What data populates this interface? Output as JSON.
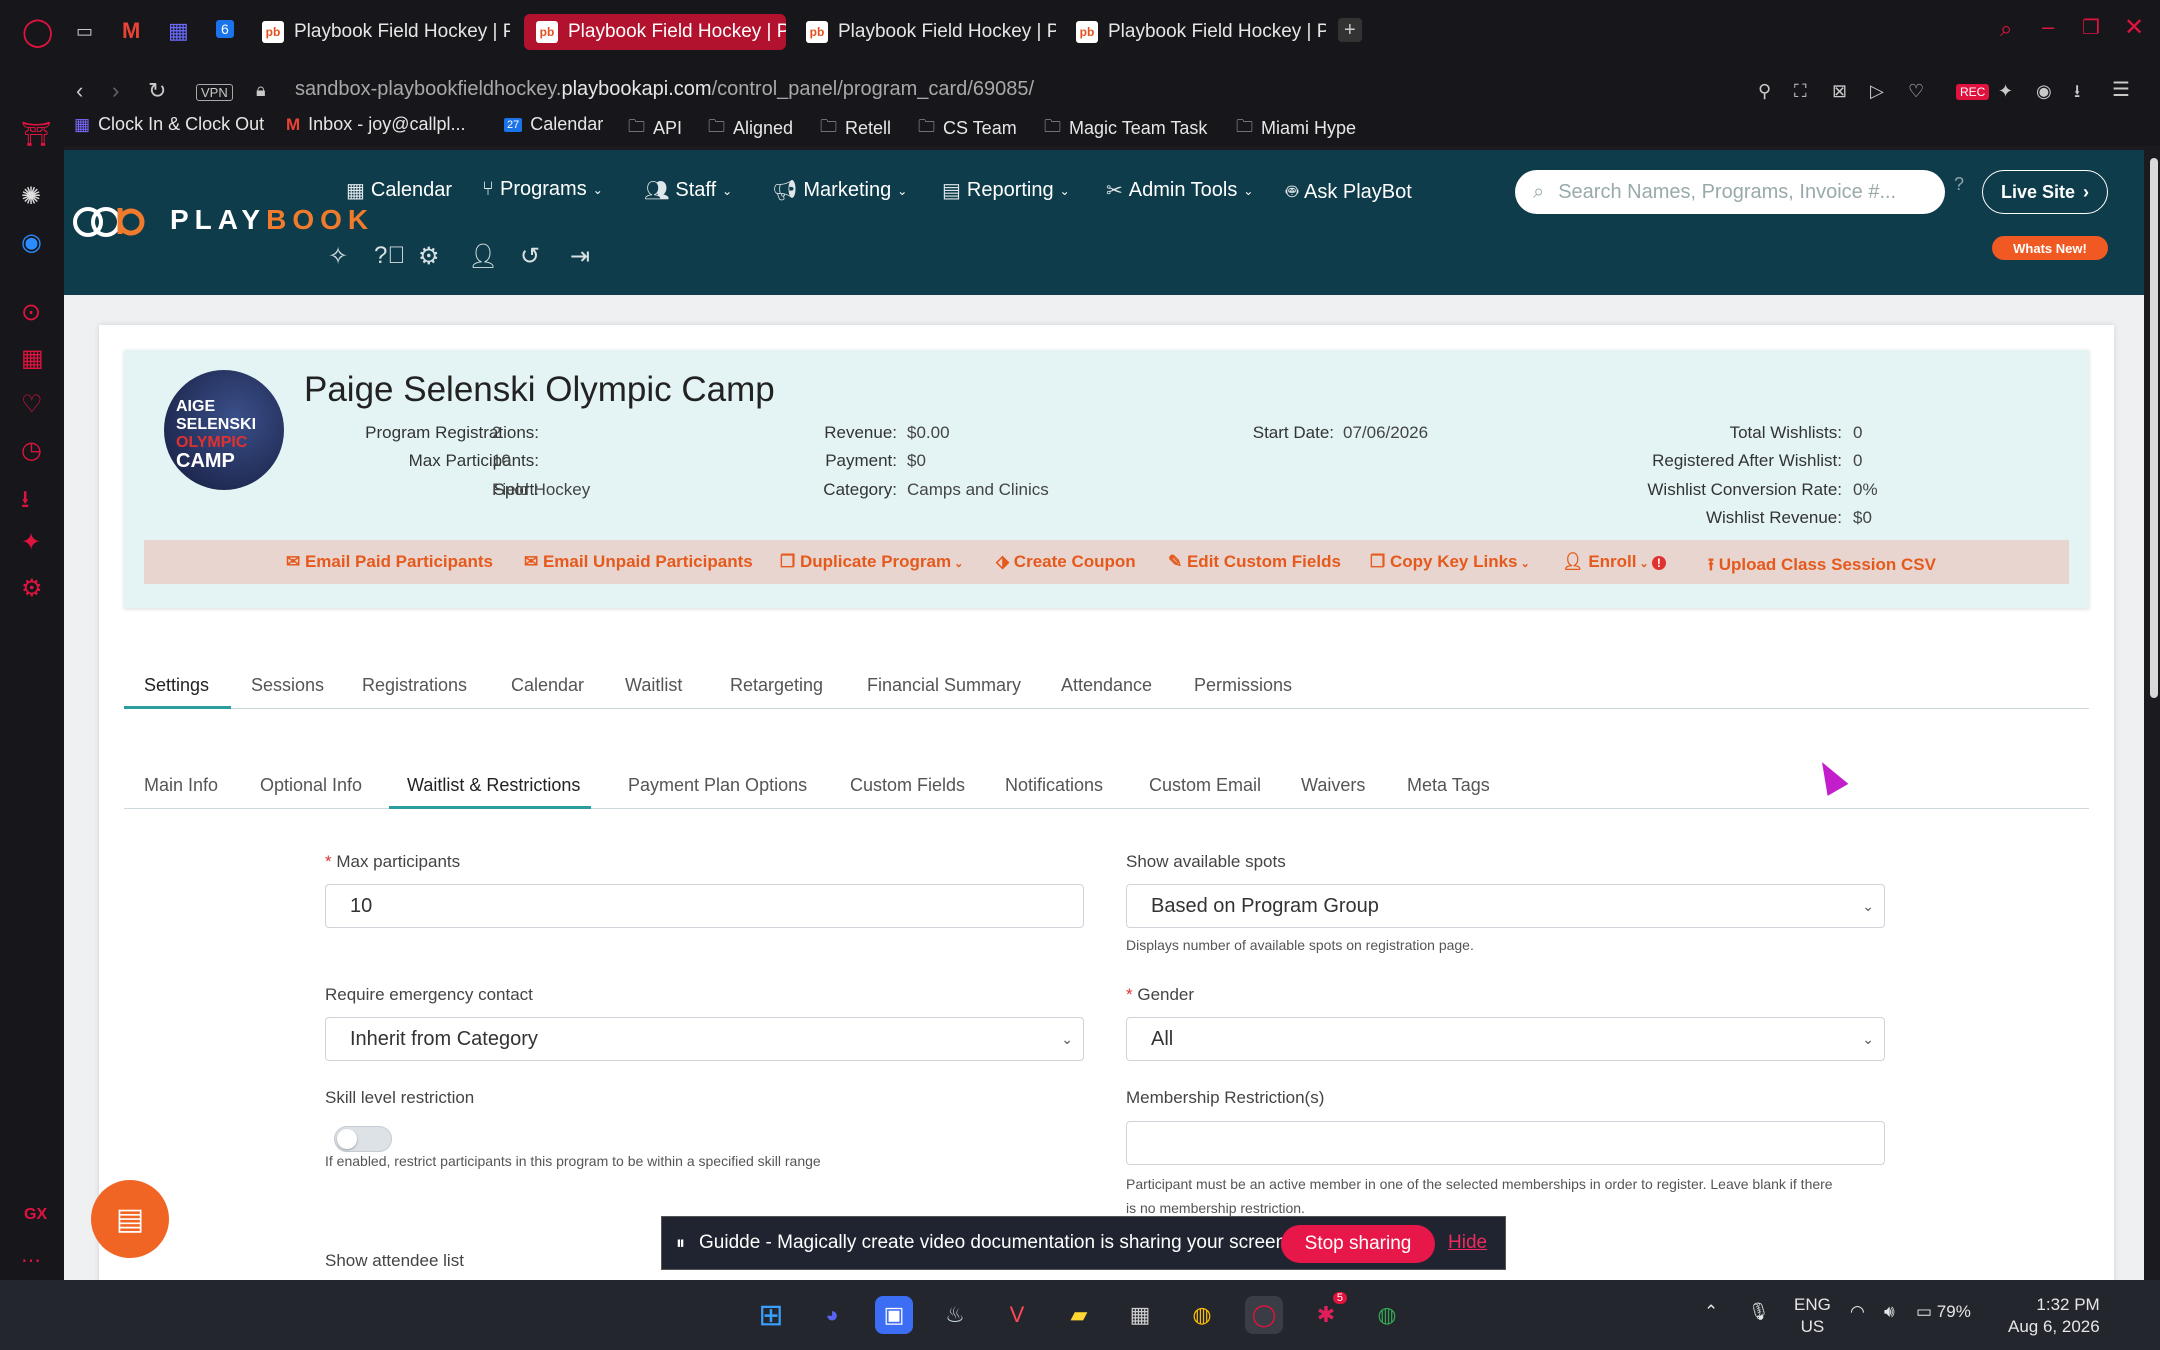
{
  "browser": {
    "tabs": [
      {
        "title": "Playbook Field Hockey | Pla",
        "active": false
      },
      {
        "title": "Playbook Field Hockey | Pla",
        "active": true
      },
      {
        "title": "Playbook Field Hockey | Pla",
        "active": false
      },
      {
        "title": "Playbook Field Hockey | Pla",
        "active": false
      }
    ],
    "vpn_label": "VPN",
    "url_prefix": "sandbox-playbookfieldhockey.",
    "url_domain": "playbookapi.com",
    "url_path": "/control_panel/program_card/69085/",
    "rec_label": "REC",
    "bookmarks": [
      {
        "label": "Clock In & Clock Out",
        "icon": "app-icon"
      },
      {
        "label": "Inbox - joy@callpl...",
        "icon": "gmail-icon"
      },
      {
        "label": "Calendar",
        "icon": "calendar-icon"
      },
      {
        "label": "API",
        "icon": "folder-icon"
      },
      {
        "label": "Aligned",
        "icon": "folder-icon"
      },
      {
        "label": "Retell",
        "icon": "folder-icon"
      },
      {
        "label": "CS Team",
        "icon": "folder-icon"
      },
      {
        "label": "Magic Team Task",
        "icon": "folder-icon"
      },
      {
        "label": "Miami Hype",
        "icon": "folder-icon"
      }
    ],
    "calendar_badge": "27",
    "sidebar_gx": "GX"
  },
  "app": {
    "logo_text_a": "PLAY",
    "logo_text_b": "BOOK",
    "nav": [
      {
        "label": "Calendar",
        "icon": "calendar-icon",
        "dropdown": false
      },
      {
        "label": "Programs",
        "icon": "programs-icon",
        "dropdown": true
      },
      {
        "label": "Staff",
        "icon": "staff-icon",
        "dropdown": true
      },
      {
        "label": "Marketing",
        "icon": "megaphone-icon",
        "dropdown": true
      },
      {
        "label": "Reporting",
        "icon": "report-icon",
        "dropdown": true
      },
      {
        "label": "Admin Tools",
        "icon": "tools-icon",
        "dropdown": true
      },
      {
        "label": "Ask PlayBot",
        "icon": "robot-icon",
        "dropdown": false
      }
    ],
    "search_placeholder": "Search Names, Programs, Invoice #...",
    "live_site_label": "Live Site",
    "whats_new_label": "Whats New!"
  },
  "program": {
    "title": "Paige Selenski Olympic Camp",
    "avatar_lines": [
      "AIGE",
      "SELENSKI",
      "OLYMPIC",
      "CAMP"
    ],
    "stats_col1": [
      {
        "label": "Program Registrations:",
        "value": "2"
      },
      {
        "label": "Max Participants:",
        "value": "10"
      },
      {
        "label": "Sport:",
        "value": "Field Hockey"
      }
    ],
    "stats_col2": [
      {
        "label": "Revenue:",
        "value": "$0.00"
      },
      {
        "label": "Payment:",
        "value": "$0"
      },
      {
        "label": "Category:",
        "value": "Camps and Clinics"
      }
    ],
    "stats_col3": [
      {
        "label": "Start Date:",
        "value": "07/06/2026"
      }
    ],
    "stats_col4": [
      {
        "label": "Total Wishlists:",
        "value": "0"
      },
      {
        "label": "Registered After Wishlist:",
        "value": "0"
      },
      {
        "label": "Wishlist Conversion Rate:",
        "value": "0%"
      },
      {
        "label": "Wishlist Revenue:",
        "value": "$0"
      }
    ],
    "actions": [
      {
        "label": "Email Paid Participants",
        "icon": "envelope-icon"
      },
      {
        "label": "Email Unpaid Participants",
        "icon": "envelope-icon"
      },
      {
        "label": "Duplicate Program",
        "icon": "copy-icon"
      },
      {
        "label": "Create Coupon",
        "icon": "tag-icon"
      },
      {
        "label": "Edit Custom Fields",
        "icon": "pencil-icon"
      },
      {
        "label": "Copy Key Links",
        "icon": "copy-icon"
      },
      {
        "label": "Enroll",
        "icon": "user-plus-icon"
      },
      {
        "label": "Upload Class Session CSV",
        "icon": "upload-icon"
      }
    ]
  },
  "tabs_main": [
    "Settings",
    "Sessions",
    "Registrations",
    "Calendar",
    "Waitlist",
    "Retargeting",
    "Financial Summary",
    "Attendance",
    "Permissions"
  ],
  "tabs_main_selected": "Settings",
  "tabs_sub": [
    "Main Info",
    "Optional Info",
    "Waitlist & Restrictions",
    "Payment Plan Options",
    "Custom Fields",
    "Notifications",
    "Custom Email",
    "Waivers",
    "Meta Tags"
  ],
  "tabs_sub_selected": "Waitlist & Restrictions",
  "form": {
    "max_participants": {
      "label": "Max participants",
      "value": "10",
      "required": true
    },
    "show_available_spots": {
      "label": "Show available spots",
      "value": "Based on Program Group",
      "hint": "Displays number of available spots on registration page."
    },
    "require_emergency_contact": {
      "label": "Require emergency contact",
      "value": "Inherit from Category"
    },
    "gender": {
      "label": "Gender",
      "value": "All",
      "required": true
    },
    "skill_level_restriction": {
      "label": "Skill level restriction",
      "enabled": false,
      "hint": "If enabled, restrict participants in this program to be within a specified skill range"
    },
    "membership_restrictions": {
      "label": "Membership Restriction(s)",
      "value": "",
      "hint_line1": "Participant must be an active member in one of the selected memberships in order to register. Leave blank if there",
      "hint_line2": "is no membership restriction."
    },
    "show_attendee_list": {
      "label": "Show attendee list"
    }
  },
  "guidde": {
    "message": "Guidde - Magically create video documentation is sharing your screen.",
    "stop_label": "Stop sharing",
    "hide_label": "Hide"
  },
  "taskbar": {
    "lang_line1": "ENG",
    "lang_line2": "US",
    "battery": "79%",
    "time": "1:32 PM",
    "date": "Aug 6, 2026",
    "notif_badge": "5"
  }
}
